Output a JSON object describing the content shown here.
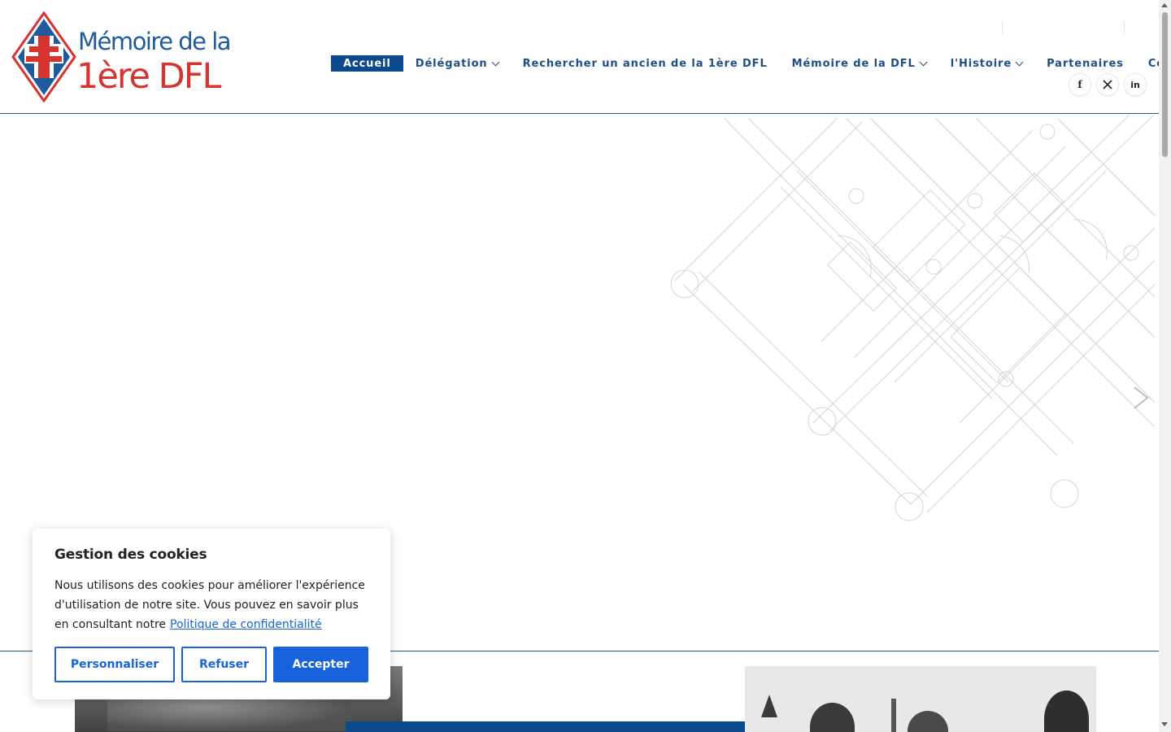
{
  "logo": {
    "line1": "Mémoire de la",
    "line2": "1ère DFL",
    "colors": {
      "blue": "#1e5a9c",
      "red": "#d8332f"
    }
  },
  "nav": {
    "items": [
      {
        "label": "Accueil",
        "active": true,
        "dropdown": false
      },
      {
        "label": "Délégation",
        "active": false,
        "dropdown": true
      },
      {
        "label": "Rechercher un ancien de la 1ère DFL",
        "active": false,
        "dropdown": false
      },
      {
        "label": "Mémoire de la DFL",
        "active": false,
        "dropdown": true
      },
      {
        "label": "l'Histoire",
        "active": false,
        "dropdown": true
      },
      {
        "label": "Partenaires",
        "active": false,
        "dropdown": false
      },
      {
        "label": "Contact",
        "active": false,
        "dropdown": false
      }
    ],
    "active_color": "#0d4a8c"
  },
  "social": {
    "items": [
      {
        "icon": "facebook-icon",
        "glyph": "f"
      },
      {
        "icon": "x-twitter-icon",
        "glyph": "𝕏"
      },
      {
        "icon": "linkedin-icon",
        "glyph": "in"
      }
    ]
  },
  "hero": {
    "next_arrow_icon": "chevron-right-icon"
  },
  "cookie": {
    "title": "Gestion des cookies",
    "text": "Nous utilisons des cookies pour améliorer l'expérience d'utilisation de notre site. Vous pouvez en savoir plus en consultant notre",
    "link": "Politique de confidentialité",
    "buttons": {
      "customize": "Personnaliser",
      "reject": "Refuser",
      "accept": "Accepter"
    },
    "accent": "#1863dc"
  }
}
